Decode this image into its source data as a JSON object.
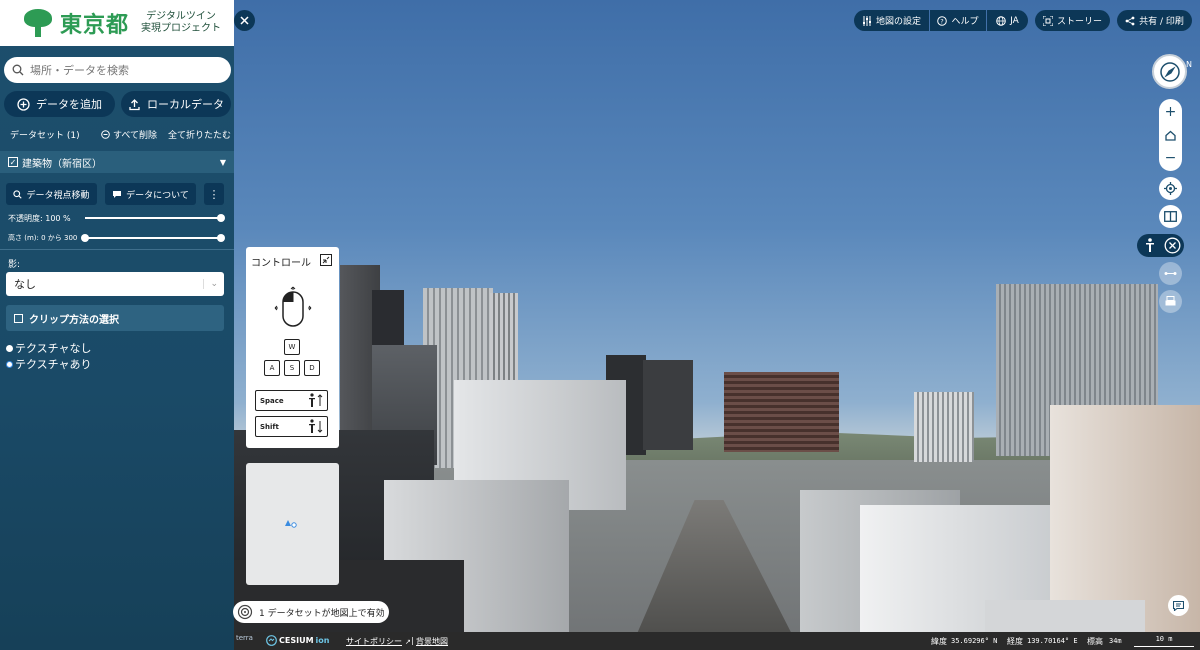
{
  "brand": {
    "name": "東京都",
    "sub1": "デジタルツイン",
    "sub2": "実現プロジェクト"
  },
  "search": {
    "placeholder": "場所・データを検索"
  },
  "buttons": {
    "add_data": "データを追加",
    "local_data": "ローカルデータ"
  },
  "datasets": {
    "label": "データセット (1)",
    "remove_all": "すべて削除",
    "collapse_all": "全て折りたたむ"
  },
  "dataset_item": {
    "title": "建築物（新宿区）",
    "view_button": "データ視点移動",
    "about_button": "データについて",
    "opacity_label": "不透明度: 100 %",
    "opacity_value": 1.0,
    "height_label": "高さ (m): 0 から 300",
    "height_range": [
      0,
      300
    ],
    "shadow_label": "影:",
    "shadow_value": "なし",
    "clip_label": "クリップ方法の選択",
    "texture_options": [
      "テクスチャなし",
      "テクスチャあり"
    ],
    "texture_selected": "テクスチャあり"
  },
  "topbar": {
    "map_settings": "地図の設定",
    "help": "ヘルプ",
    "lang": "JA",
    "story": "ストーリー",
    "share": "共有 / 印刷"
  },
  "control": {
    "title": "コントロール",
    "keys": {
      "w": "W",
      "a": "A",
      "s": "S",
      "d": "D",
      "space": "Space",
      "shift": "Shift"
    }
  },
  "compass": {
    "n": "N"
  },
  "status": {
    "text": "1 データセットが地図上で有効"
  },
  "footer": {
    "terra": "terra",
    "cesium": "CESIUM",
    "ion": "ion",
    "policy": "サイトポリシー",
    "sep": "|",
    "background": "背景地図",
    "lat_label": "緯度",
    "lat": "35.69296° N",
    "lon_label": "経度",
    "lon": "139.70164° E",
    "alt_label": "標高",
    "alt": "34m",
    "scale": "10 m"
  },
  "colors": {
    "panel": "#1d4f6d",
    "button": "#0c3757",
    "brand": "#2d9b54"
  }
}
